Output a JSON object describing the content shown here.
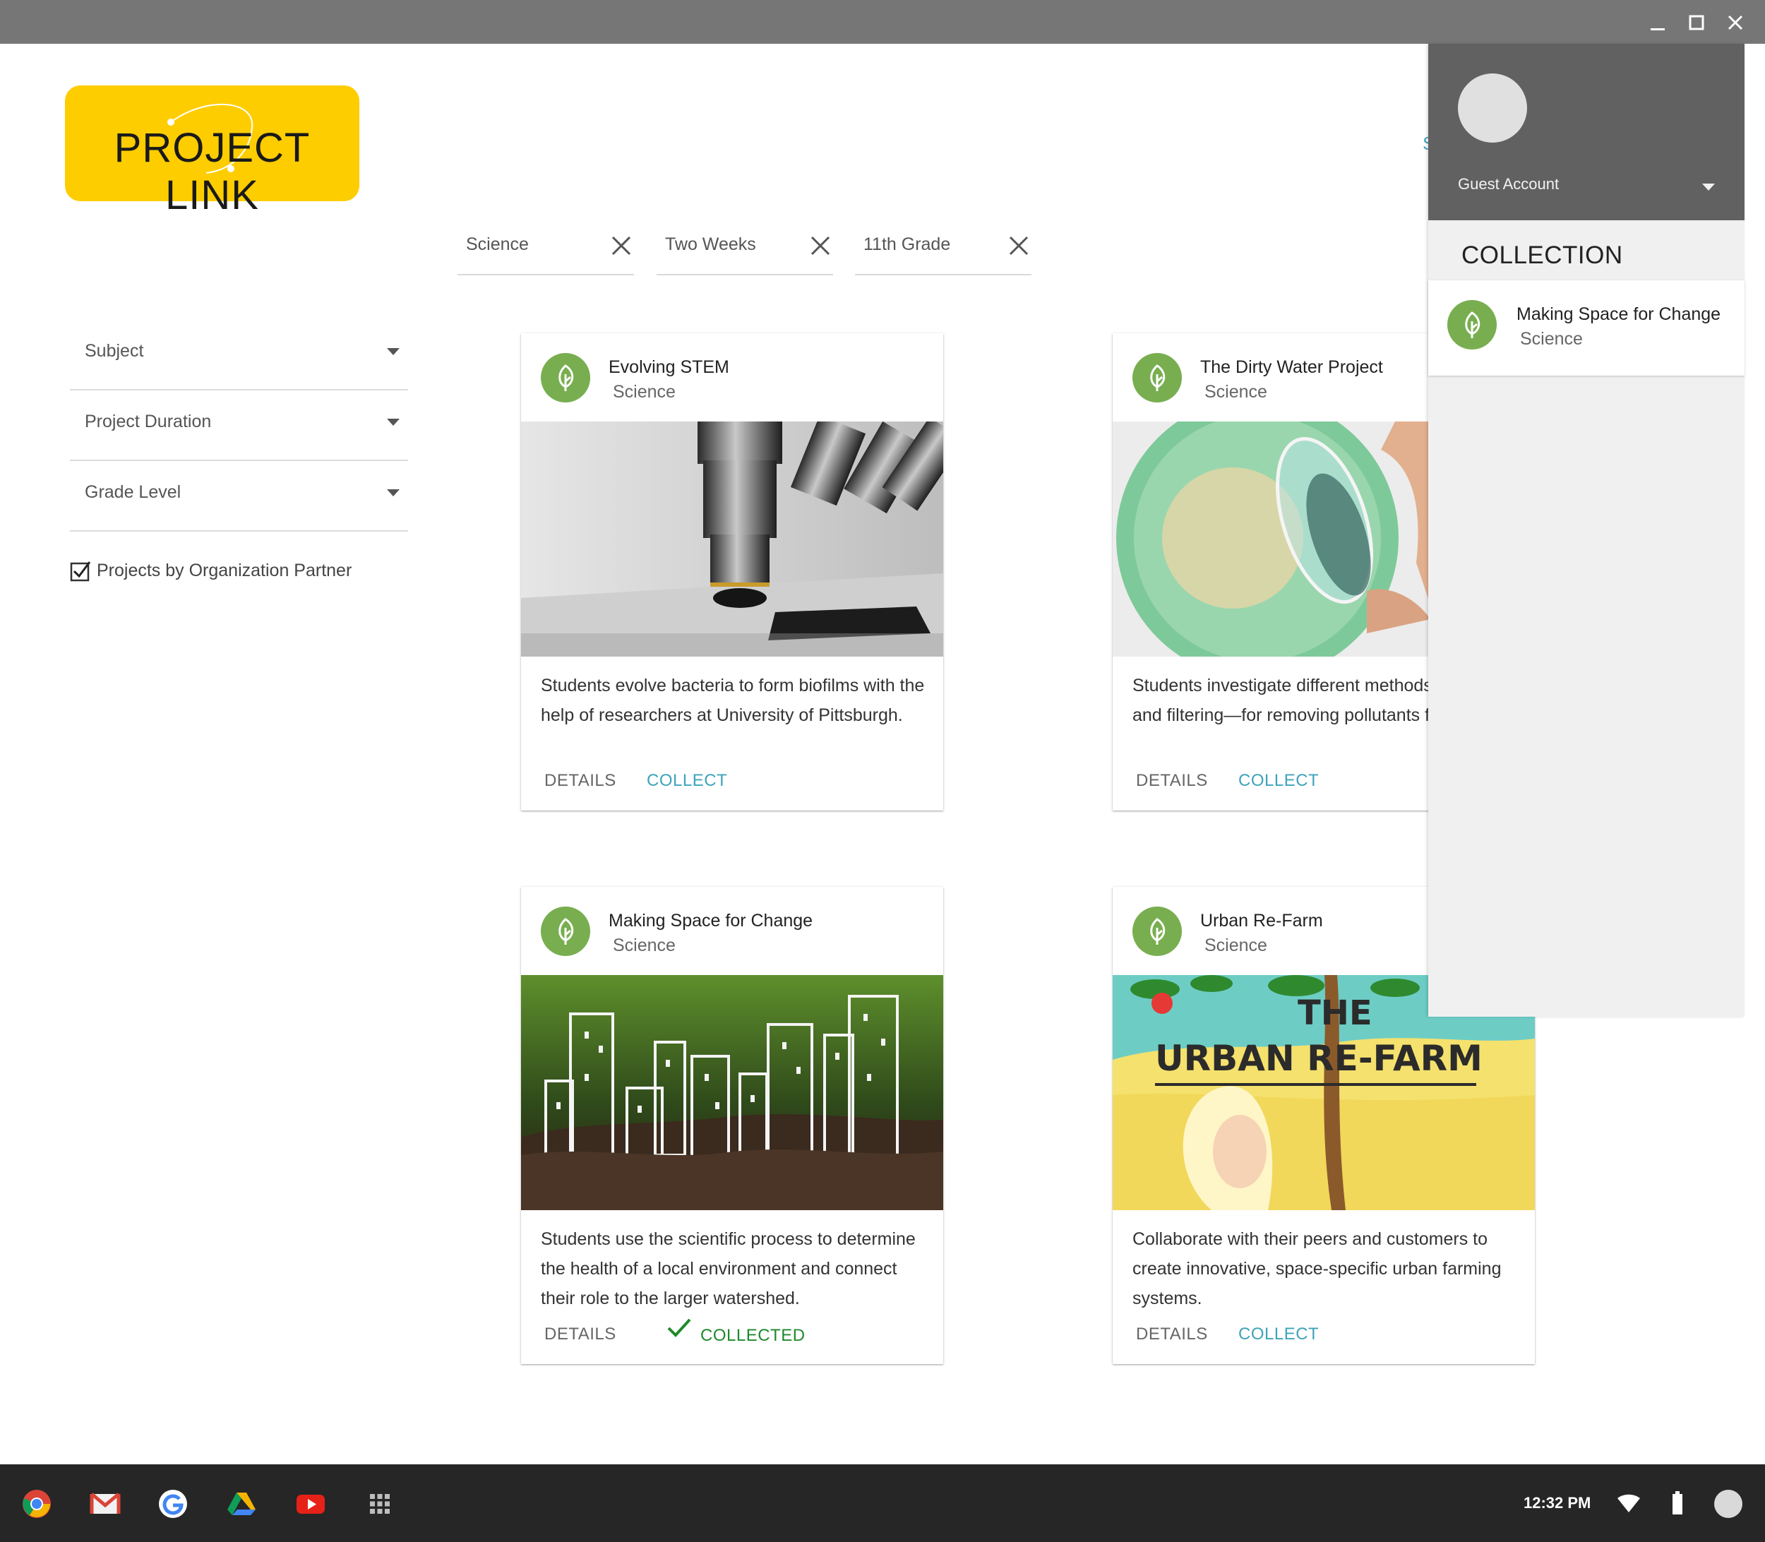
{
  "window": {
    "minimize_icon": "minimize-icon",
    "maximize_icon": "maximize-icon",
    "close_icon": "close-icon"
  },
  "logo": {
    "text": "PROJECT LINK",
    "bg_color": "#FECD00"
  },
  "partial_link": "S",
  "active_filters": [
    {
      "label": "Science"
    },
    {
      "label": "Two Weeks"
    },
    {
      "label": "11th Grade"
    }
  ],
  "sidebar": {
    "filters": [
      {
        "label": "Subject"
      },
      {
        "label": "Project Duration"
      },
      {
        "label": "Grade Level"
      }
    ],
    "partner_checkbox": {
      "label": "Projects by Organization Partner",
      "checked": true
    }
  },
  "cards": [
    {
      "title": "Evolving STEM",
      "subject": "Science",
      "image": "microscope",
      "description": "Students evolve bacteria to form biofilms with the help of researchers at University of Pittsburgh.",
      "details_label": "DETAILS",
      "action_label": "COLLECT",
      "collected": false
    },
    {
      "title": "The Dirty Water Project",
      "subject": "Science",
      "image": "water-filtering",
      "description": "Students investigate different methods—aeration and filtering—for removing pollutants from water.",
      "details_label": "DETAILS",
      "action_label": "COLLECT",
      "collected": false
    },
    {
      "title": "Making Space for Change",
      "subject": "Science",
      "image": "city-sketch-on-soil",
      "description": "Students use the scientific process to determine the health of a local environment and connect their role to the larger watershed.",
      "details_label": "DETAILS",
      "action_label": "COLLECTED",
      "collected": true
    },
    {
      "title": "Urban Re-Farm",
      "subject": "Science",
      "image": "urban-re-farm-poster",
      "image_text_1": "THE",
      "image_text_2": "URBAN RE-FARM",
      "description": "Collaborate with their peers and customers to create innovative, space-specific urban farming systems.",
      "details_label": "DETAILS",
      "action_label": "COLLECT",
      "collected": false
    }
  ],
  "account_panel": {
    "account_name": "Guest Account",
    "collection_title": "COLLECTION",
    "collection_items": [
      {
        "title": "Making Space for Change",
        "subject": "Science"
      }
    ]
  },
  "shelf": {
    "apps": [
      "chrome-icon",
      "gmail-icon",
      "google-icon",
      "drive-icon",
      "youtube-icon",
      "app-launcher-icon"
    ],
    "time": "12:32 PM"
  },
  "colors": {
    "accent_collect": "#3fa3ba",
    "collected_green": "#1f8a2c",
    "leaf_avatar": "#78AE4F",
    "panel_header": "#616161"
  }
}
